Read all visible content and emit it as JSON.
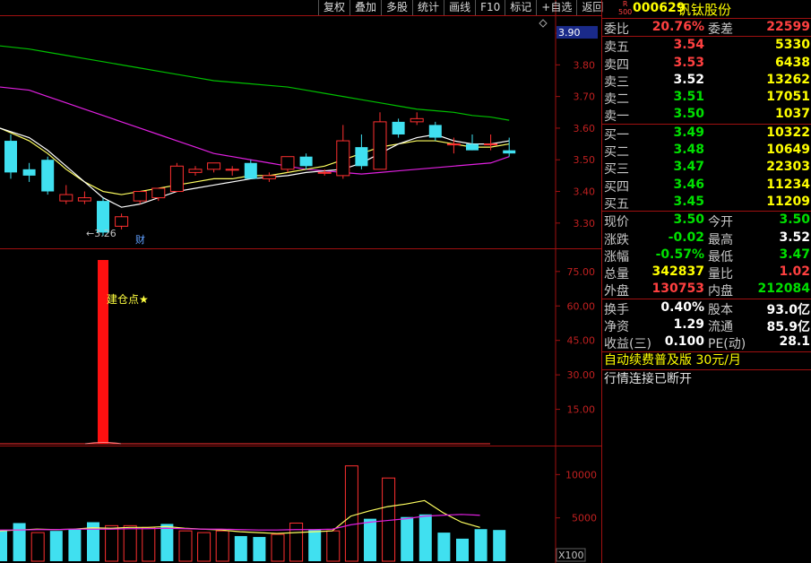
{
  "toolbar": [
    "复权",
    "叠加",
    "多股",
    "统计",
    "画线",
    "F10",
    "标记",
    "+自选",
    "返回"
  ],
  "stock": {
    "tag_top": "R",
    "tag_bottom": "500",
    "code": "000629",
    "name": "钒钛股份"
  },
  "quote": {
    "weibi": {
      "label": "委比",
      "value": "20.76%",
      "label2": "委差",
      "value2": "22599"
    },
    "asks": [
      {
        "label": "卖五",
        "price": "3.54",
        "vol": "5330",
        "color": "red"
      },
      {
        "label": "卖四",
        "price": "3.53",
        "vol": "6438",
        "color": "red"
      },
      {
        "label": "卖三",
        "price": "3.52",
        "vol": "13262",
        "color": "white"
      },
      {
        "label": "卖二",
        "price": "3.51",
        "vol": "17051",
        "color": "green"
      },
      {
        "label": "卖一",
        "price": "3.50",
        "vol": "1037",
        "color": "green"
      }
    ],
    "bids": [
      {
        "label": "买一",
        "price": "3.49",
        "vol": "10322",
        "color": "green"
      },
      {
        "label": "买二",
        "price": "3.48",
        "vol": "10649",
        "color": "green"
      },
      {
        "label": "买三",
        "price": "3.47",
        "vol": "22303",
        "color": "green"
      },
      {
        "label": "买四",
        "price": "3.46",
        "vol": "11234",
        "color": "green"
      },
      {
        "label": "买五",
        "price": "3.45",
        "vol": "11209",
        "color": "green"
      }
    ],
    "stats": [
      {
        "l1": "现价",
        "v1": "3.50",
        "c1": "green",
        "l2": "今开",
        "v2": "3.50",
        "c2": "green"
      },
      {
        "l1": "涨跌",
        "v1": "-0.02",
        "c1": "green",
        "l2": "最高",
        "v2": "3.52",
        "c2": "white"
      },
      {
        "l1": "涨幅",
        "v1": "-0.57%",
        "c1": "green",
        "l2": "最低",
        "v2": "3.47",
        "c2": "green"
      },
      {
        "l1": "总量",
        "v1": "342837",
        "c1": "yellow",
        "l2": "量比",
        "v2": "1.02",
        "c2": "red"
      },
      {
        "l1": "外盘",
        "v1": "130753",
        "c1": "red",
        "l2": "内盘",
        "v2": "212084",
        "c2": "green"
      }
    ],
    "fundamentals": [
      {
        "l1": "换手",
        "v1": "0.40%",
        "l2": "股本",
        "v2": "93.0亿"
      },
      {
        "l1": "净资",
        "v1": "1.29",
        "l2": "流通",
        "v2": "85.9亿"
      },
      {
        "l1": "收益(三)",
        "v1": "0.100",
        "l2": "PE(动)",
        "v2": "28.1"
      }
    ],
    "promo": {
      "text": "自动续费普及版",
      "price": "30元/月"
    },
    "status": "行情连接已断开"
  },
  "chart_data": [
    {
      "type": "candlestick",
      "current_price_label": "3.90",
      "y_ticks": [
        "3.90",
        "3.80",
        "3.70",
        "3.60",
        "3.50",
        "3.40",
        "3.30"
      ],
      "ylim": [
        3.24,
        3.92
      ],
      "annotations": [
        {
          "text": "←3.26",
          "at": 4
        },
        {
          "text": "财",
          "at": 7
        }
      ],
      "candles": [
        {
          "o": 3.56,
          "c": 3.46,
          "h": 3.58,
          "l": 3.44
        },
        {
          "o": 3.47,
          "c": 3.45,
          "h": 3.49,
          "l": 3.43
        },
        {
          "o": 3.5,
          "c": 3.4,
          "h": 3.51,
          "l": 3.39
        },
        {
          "o": 3.37,
          "c": 3.39,
          "h": 3.42,
          "l": 3.36
        },
        {
          "o": 3.37,
          "c": 3.38,
          "h": 3.4,
          "l": 3.36
        },
        {
          "o": 3.37,
          "c": 3.27,
          "h": 3.38,
          "l": 3.26
        },
        {
          "o": 3.29,
          "c": 3.32,
          "h": 3.33,
          "l": 3.28
        },
        {
          "o": 3.37,
          "c": 3.4,
          "h": 3.4,
          "l": 3.36
        },
        {
          "o": 3.38,
          "c": 3.41,
          "h": 3.41,
          "l": 3.37
        },
        {
          "o": 3.4,
          "c": 3.48,
          "h": 3.49,
          "l": 3.4
        },
        {
          "o": 3.46,
          "c": 3.47,
          "h": 3.48,
          "l": 3.45
        },
        {
          "o": 3.47,
          "c": 3.49,
          "h": 3.49,
          "l": 3.46
        },
        {
          "o": 3.47,
          "c": 3.47,
          "h": 3.48,
          "l": 3.45
        },
        {
          "o": 3.49,
          "c": 3.44,
          "h": 3.5,
          "l": 3.44
        },
        {
          "o": 3.44,
          "c": 3.45,
          "h": 3.46,
          "l": 3.43
        },
        {
          "o": 3.47,
          "c": 3.51,
          "h": 3.51,
          "l": 3.46
        },
        {
          "o": 3.51,
          "c": 3.48,
          "h": 3.52,
          "l": 3.47
        },
        {
          "o": 3.46,
          "c": 3.46,
          "h": 3.47,
          "l": 3.45
        },
        {
          "o": 3.45,
          "c": 3.56,
          "h": 3.61,
          "l": 3.44
        },
        {
          "o": 3.54,
          "c": 3.48,
          "h": 3.58,
          "l": 3.47
        },
        {
          "o": 3.47,
          "c": 3.62,
          "h": 3.65,
          "l": 3.47
        },
        {
          "o": 3.62,
          "c": 3.58,
          "h": 3.63,
          "l": 3.57
        },
        {
          "o": 3.62,
          "c": 3.63,
          "h": 3.65,
          "l": 3.61
        },
        {
          "o": 3.61,
          "c": 3.57,
          "h": 3.62,
          "l": 3.56
        },
        {
          "o": 3.55,
          "c": 3.55,
          "h": 3.57,
          "l": 3.52
        },
        {
          "o": 3.55,
          "c": 3.53,
          "h": 3.58,
          "l": 3.53
        },
        {
          "o": 3.55,
          "c": 3.55,
          "h": 3.58,
          "l": 3.53
        },
        {
          "o": 3.53,
          "c": 3.52,
          "h": 3.57,
          "l": 3.51
        }
      ],
      "ma_long": [
        3.86,
        3.85,
        3.84,
        3.83,
        3.82,
        3.81,
        3.8,
        3.79,
        3.78,
        3.77,
        3.76,
        3.75,
        3.745,
        3.74,
        3.735,
        3.73,
        3.72,
        3.71,
        3.7,
        3.69,
        3.68,
        3.67,
        3.66,
        3.655,
        3.65,
        3.64,
        3.635,
        3.625
      ],
      "ma_mid": [
        3.73,
        3.72,
        3.7,
        3.68,
        3.66,
        3.64,
        3.62,
        3.6,
        3.58,
        3.56,
        3.54,
        3.52,
        3.51,
        3.5,
        3.49,
        3.48,
        3.47,
        3.465,
        3.46,
        3.455,
        3.46,
        3.465,
        3.47,
        3.475,
        3.48,
        3.485,
        3.49,
        3.51
      ],
      "ma_short": [
        3.6,
        3.57,
        3.53,
        3.48,
        3.43,
        3.38,
        3.35,
        3.36,
        3.38,
        3.4,
        3.41,
        3.42,
        3.43,
        3.44,
        3.445,
        3.45,
        3.46,
        3.465,
        3.47,
        3.49,
        3.52,
        3.55,
        3.57,
        3.58,
        3.56,
        3.55,
        3.55,
        3.56
      ],
      "ma_short2": [
        3.6,
        3.56,
        3.52,
        3.47,
        3.43,
        3.4,
        3.39,
        3.4,
        3.41,
        3.42,
        3.43,
        3.44,
        3.44,
        3.45,
        3.45,
        3.46,
        3.47,
        3.48,
        3.5,
        3.52,
        3.54,
        3.55,
        3.56,
        3.56,
        3.55,
        3.54,
        3.54,
        3.55
      ]
    },
    {
      "type": "bar",
      "title": "",
      "y_ticks": [
        "75.00",
        "60.00",
        "45.00",
        "30.00",
        "15.00"
      ],
      "ylim": [
        0,
        80
      ],
      "signal_index": 5,
      "signal_value": 80,
      "label": "建仓点★"
    },
    {
      "type": "bar",
      "y_ticks": [
        "10000",
        "5000"
      ],
      "unit": "X100",
      "ylim": [
        0,
        12000
      ],
      "volumes": [
        3500,
        4400,
        3300,
        3500,
        3700,
        4500,
        4100,
        4100,
        3900,
        4300,
        3500,
        3300,
        3500,
        2900,
        2800,
        3100,
        4400,
        3600,
        3500,
        11000,
        4900,
        9600,
        5100,
        5400,
        3300,
        2600,
        3700,
        3600,
        3300
      ],
      "up": [
        false,
        false,
        true,
        false,
        false,
        false,
        true,
        true,
        true,
        false,
        true,
        true,
        true,
        false,
        false,
        true,
        true,
        false,
        true,
        true,
        false,
        true,
        false,
        false,
        false,
        false,
        false,
        false,
        false
      ],
      "vol_ma1": [
        3500,
        3600,
        3700,
        3650,
        3700,
        3850,
        3800,
        3900,
        3900,
        4000,
        3800,
        3700,
        3600,
        3400,
        3300,
        3200,
        3300,
        3400,
        3500,
        5200,
        5800,
        6300,
        6600,
        7000,
        5600,
        4500,
        3900,
        3700,
        3300
      ],
      "vol_ma2": [
        3600,
        3600,
        3650,
        3650,
        3700,
        3700,
        3700,
        3750,
        3750,
        3800,
        3750,
        3700,
        3700,
        3650,
        3600,
        3600,
        3650,
        3650,
        3700,
        4200,
        4500,
        4700,
        4900,
        5200,
        5300,
        5400,
        5300,
        5300,
        5200
      ]
    }
  ]
}
